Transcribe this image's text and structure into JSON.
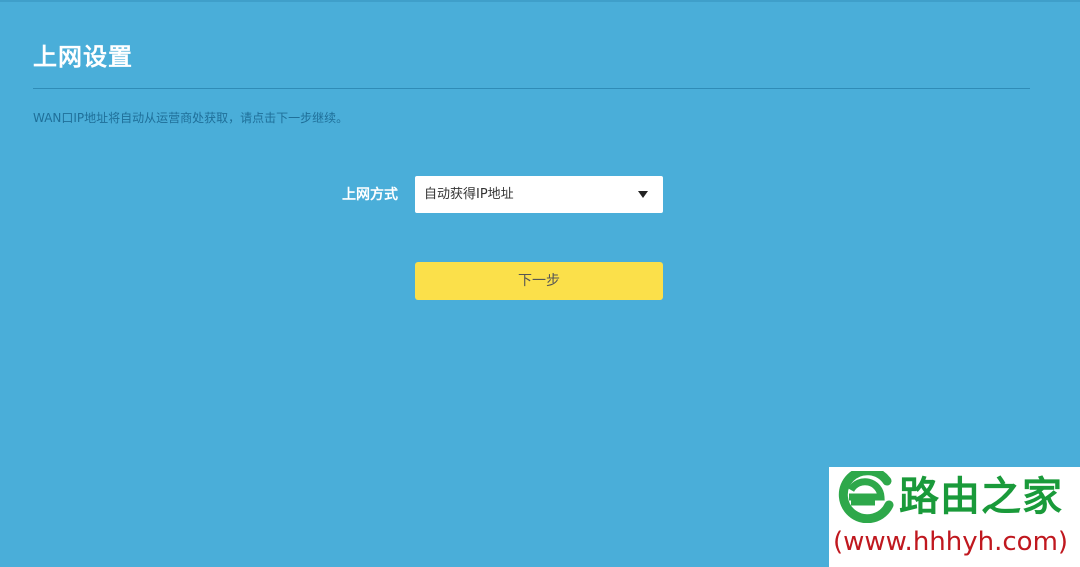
{
  "page": {
    "title": "上网设置",
    "hint": "WAN口IP地址将自动从运营商处获取，请点击下一步继续。"
  },
  "form": {
    "connection_label": "上网方式",
    "connection_value": "自动获得IP地址"
  },
  "actions": {
    "next_label": "下一步"
  },
  "watermark": {
    "name": "路由之家",
    "url": "(www.hhhyh.com)"
  },
  "colors": {
    "background": "#4aaed9",
    "button": "#fbe04a",
    "watermark_green": "#1a9a3a",
    "watermark_red": "#c0181f"
  }
}
